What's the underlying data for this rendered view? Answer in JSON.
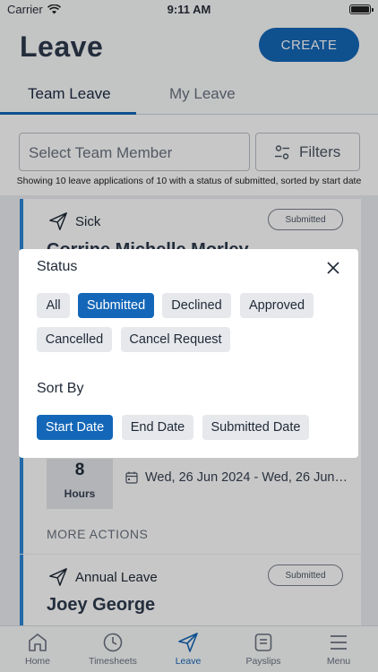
{
  "status_bar": {
    "carrier": "Carrier",
    "time": "9:11 AM"
  },
  "header": {
    "title": "Leave",
    "create_label": "CREATE"
  },
  "tabs": [
    {
      "label": "Team Leave",
      "active": true
    },
    {
      "label": "My Leave",
      "active": false
    }
  ],
  "filters": {
    "member_placeholder": "Select Team Member",
    "filters_label": "Filters",
    "showing_text": "Showing 10 leave applications of 10 with a status of submitted, sorted by start date"
  },
  "cards": [
    {
      "type": "Sick",
      "status": "Submitted",
      "name": "Corrine Michelle Morley",
      "hours": "8",
      "hours_label": "Hours",
      "dates": "Wed, 26 Jun 2024 - Wed, 26 Jun…",
      "more_actions": "MORE ACTIONS"
    },
    {
      "type": "Annual Leave",
      "status": "Submitted",
      "name": "Joey George"
    }
  ],
  "nav": [
    {
      "label": "Home",
      "icon": "home-icon",
      "active": false
    },
    {
      "label": "Timesheets",
      "icon": "clock-icon",
      "active": false
    },
    {
      "label": "Leave",
      "icon": "send-icon",
      "active": true
    },
    {
      "label": "Payslips",
      "icon": "payslip-icon",
      "active": false
    },
    {
      "label": "Menu",
      "icon": "menu-icon",
      "active": false
    }
  ],
  "modal": {
    "status_title": "Status",
    "status_options": [
      {
        "label": "All",
        "selected": false
      },
      {
        "label": "Submitted",
        "selected": true
      },
      {
        "label": "Declined",
        "selected": false
      },
      {
        "label": "Approved",
        "selected": false
      },
      {
        "label": "Cancelled",
        "selected": false
      },
      {
        "label": "Cancel Request",
        "selected": false
      }
    ],
    "sort_title": "Sort By",
    "sort_options": [
      {
        "label": "Start Date",
        "selected": true
      },
      {
        "label": "End Date",
        "selected": false
      },
      {
        "label": "Submitted Date",
        "selected": false
      }
    ]
  },
  "colors": {
    "primary": "#1467b8",
    "card_accent": "#2b87d6",
    "chip_bg": "#e6e8ec"
  }
}
